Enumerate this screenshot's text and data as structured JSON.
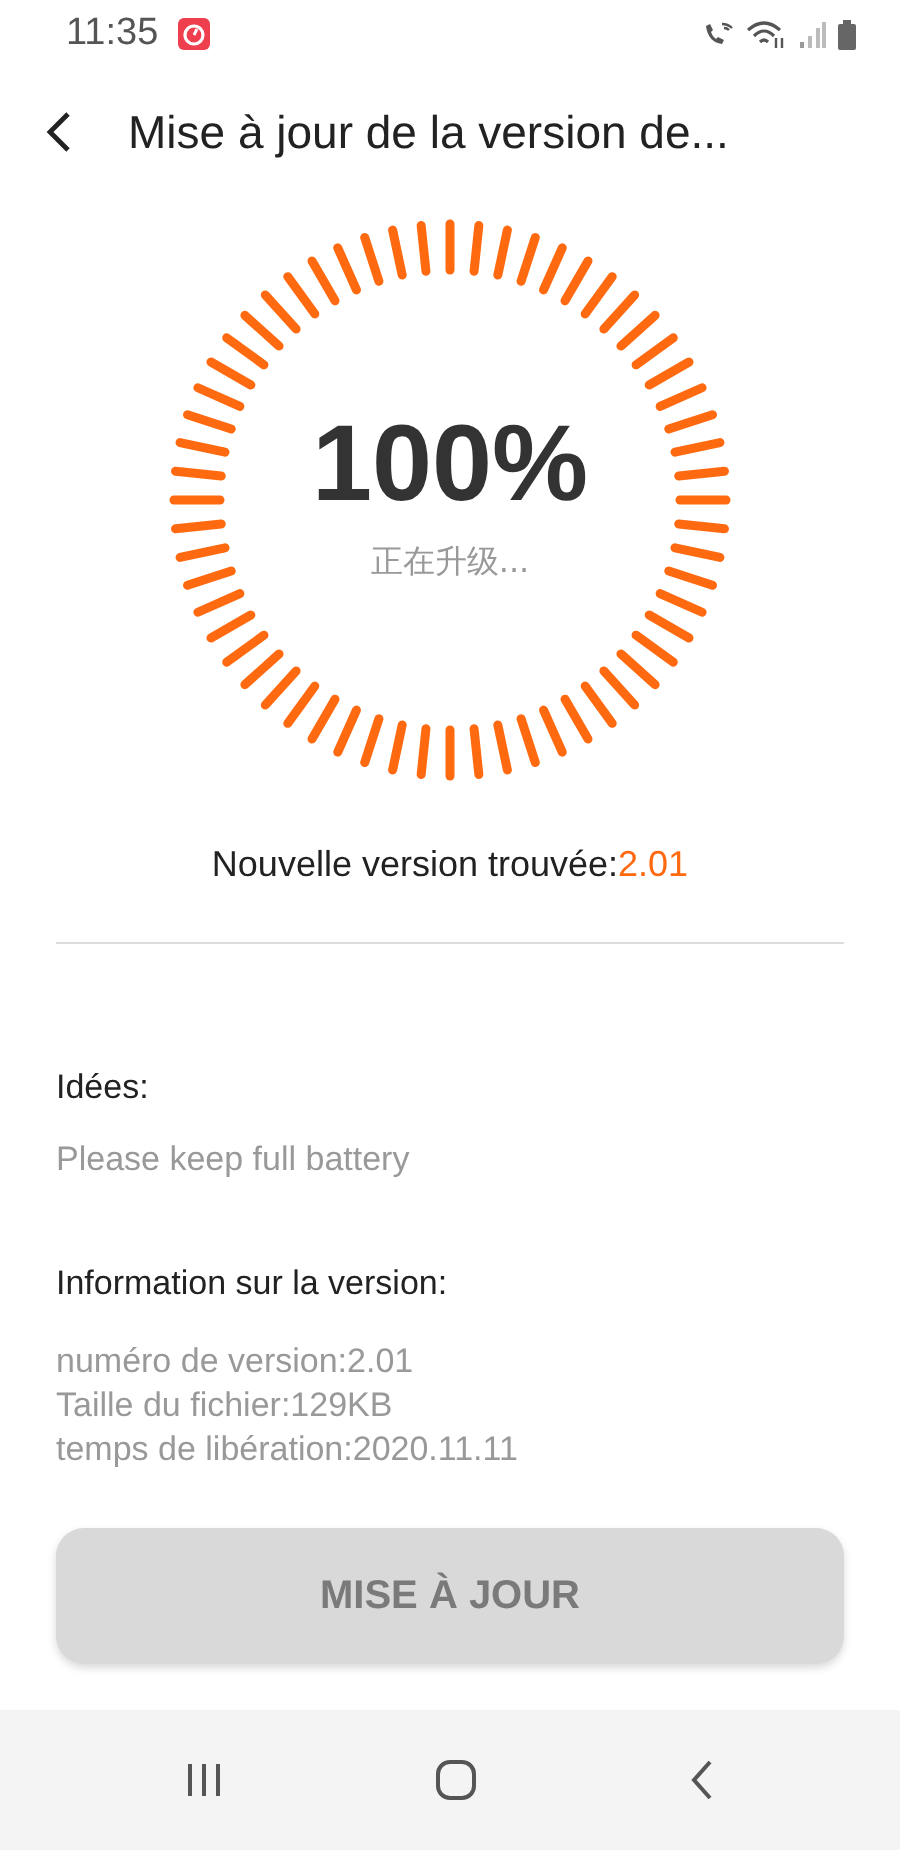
{
  "status_bar": {
    "time": "11:35"
  },
  "header": {
    "title": "Mise à jour de la version de..."
  },
  "progress": {
    "percent": "100%",
    "status": "正在升级..."
  },
  "found": {
    "label": "Nouvelle version trouvée:",
    "version": "2.01"
  },
  "ideas": {
    "heading": "Idées:",
    "text": "Please keep full battery"
  },
  "info": {
    "heading": "Information sur la version:",
    "lines": [
      "numéro de version:2.01",
      "Taille du fichier:129KB",
      "temps de libération:2020.11.11"
    ]
  },
  "update_button": {
    "label": "MISE À JOUR",
    "disabled": true
  }
}
